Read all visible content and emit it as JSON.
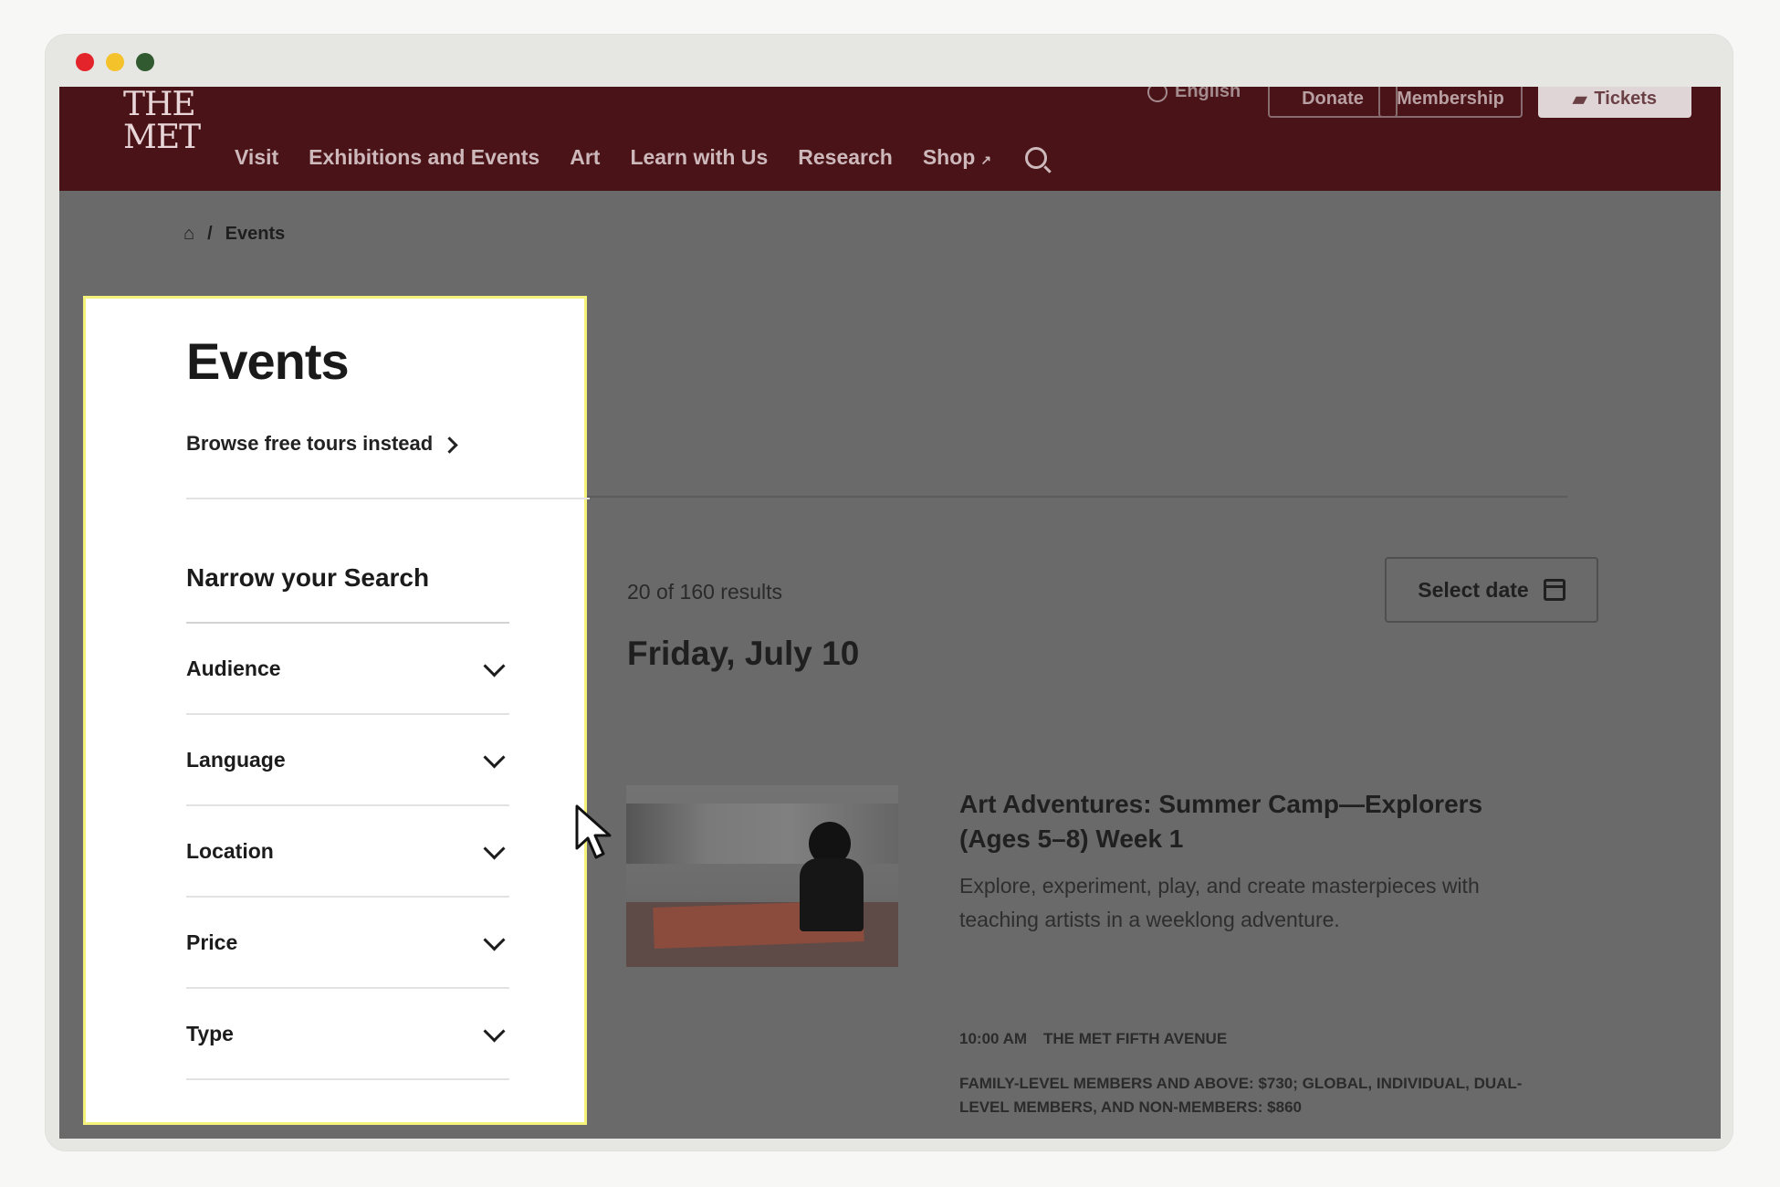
{
  "site": {
    "logo_text": "THE MET",
    "utility": {
      "language": "English",
      "donate": "Donate",
      "membership": "Membership",
      "tickets": "Tickets"
    },
    "nav": [
      "Visit",
      "Exhibitions and Events",
      "Art",
      "Learn with Us",
      "Research",
      "Shop"
    ]
  },
  "breadcrumb": {
    "separator": "/",
    "current": "Events"
  },
  "filter_panel": {
    "title": "Events",
    "browse_link": "Browse free tours instead",
    "narrow_heading": "Narrow your Search",
    "filters": [
      "Audience",
      "Language",
      "Location",
      "Price",
      "Type"
    ]
  },
  "results": {
    "count_text": "20 of 160 results",
    "select_date_label": "Select date",
    "day_heading": "Friday, July 10"
  },
  "event": {
    "title": "Art Adventures: Summer Camp—Explorers (Ages 5–8) Week 1",
    "description": "Explore, experiment, play, and create masterpieces with teaching artists in a weeklong adventure.",
    "time": "10:00 AM",
    "location": "THE MET FIFTH AVENUE",
    "price": "FAMILY-LEVEL MEMBERS AND ABOVE: $730; GLOBAL, INDIVIDUAL, DUAL-LEVEL MEMBERS, AND NON-MEMBERS: $860"
  },
  "colors": {
    "header": "#4a1318",
    "overlay": "#6a6a6a",
    "highlight_border": "#f4f27b"
  }
}
